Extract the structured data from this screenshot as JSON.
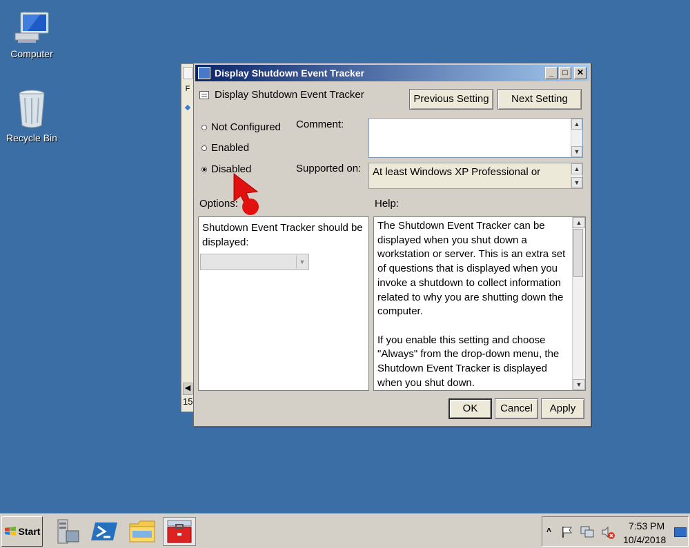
{
  "desktop": {
    "icons": [
      {
        "label": "Computer",
        "icon": "computer-icon"
      },
      {
        "label": "Recycle Bin",
        "icon": "recycle-bin-icon"
      }
    ]
  },
  "dialog": {
    "title": "Display Shutdown Event Tracker",
    "setting_name": "Display Shutdown Event Tracker",
    "prev_button": "Previous Setting",
    "next_button": "Next Setting",
    "radios": [
      {
        "label": "Not Configured",
        "selected": false
      },
      {
        "label": "Enabled",
        "selected": false
      },
      {
        "label": "Disabled",
        "selected": true
      }
    ],
    "comment_label": "Comment:",
    "supported_label": "Supported on:",
    "supported_value": "At least Windows XP Professional or",
    "options_label": "Options:",
    "help_label": "Help:",
    "options_text": "Shutdown Event Tracker should be displayed:",
    "help_paragraphs": [
      "The Shutdown Event Tracker can be displayed when you shut down a workstation or server.  This is an extra set of questions that is displayed when you invoke a shutdown to collect information related to why you are shutting down the computer.",
      "If you enable this setting and choose \"Always\" from the drop-down menu, the Shutdown Event Tracker is displayed when you shut down."
    ],
    "ok_button": "OK",
    "cancel_button": "Cancel",
    "apply_button": "Apply"
  },
  "background_window": {
    "fragments": [
      "F",
      "15"
    ]
  },
  "taskbar": {
    "start_label": "Start",
    "time": "7:53 PM",
    "date": "10/4/2018",
    "tray_icons": [
      "chevron-up-icon",
      "flag-icon",
      "network-icon",
      "speaker-muted-icon"
    ],
    "apps": [
      "server-manager-icon",
      "powershell-icon",
      "explorer-icon",
      "toolbox-icon"
    ]
  },
  "colors": {
    "desktop": "#3a6ea5",
    "titlebar_start": "#0a246a",
    "titlebar_end": "#a6caf0",
    "pointer": "#e31010"
  }
}
